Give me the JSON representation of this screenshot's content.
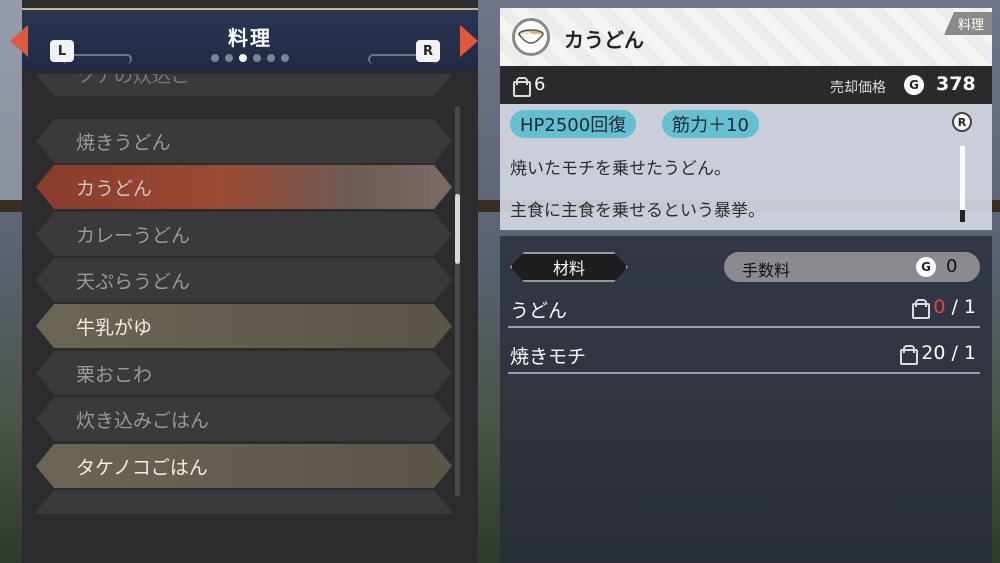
{
  "recipe_menu": {
    "title": "料理",
    "left_key": "L",
    "right_key": "R",
    "page_count": 6,
    "active_page": 3,
    "items": [
      {
        "label": "ツナの炊込ご",
        "state": "partial"
      },
      {
        "label": "焼きうどん",
        "state": "unavailable"
      },
      {
        "label": "カうどん",
        "state": "selected"
      },
      {
        "label": "カレーうどん",
        "state": "unavailable"
      },
      {
        "label": "天ぷらうどん",
        "state": "unavailable"
      },
      {
        "label": "牛乳がゆ",
        "state": "cookable"
      },
      {
        "label": "栗おこわ",
        "state": "unavailable"
      },
      {
        "label": "炊き込みごはん",
        "state": "unavailable"
      },
      {
        "label": "タケノコごはん",
        "state": "cookable"
      },
      {
        "label": "",
        "state": "partial"
      }
    ]
  },
  "detail": {
    "dish_name": "カうどん",
    "category": "料理",
    "dish_icon": "udon-bowl-icon",
    "owned_count": "6",
    "sell_label": "売却価格",
    "currency_symbol": "G",
    "sell_value": "378",
    "effects": [
      "HP2500回復",
      "筋力＋10"
    ],
    "description_lines": [
      "焼いたモチを乗せたうどん。",
      "主食に主食を乗せるという暴挙。"
    ],
    "scroll_key": "R"
  },
  "materials": {
    "tab_label": "材料",
    "fee_label": "手数料",
    "fee_currency": "G",
    "fee_value": "0",
    "rows": [
      {
        "name": "うどん",
        "have": "0",
        "need": "/ 1",
        "insufficient": true
      },
      {
        "name": "焼きモチ",
        "have": "20",
        "need": "/ 1",
        "insufficient": false
      }
    ]
  },
  "colors": {
    "selected": "#9a4a35",
    "cookable": "#6b6555",
    "unavailable": "#3a3a3d",
    "effect_badge": "#64bfd0",
    "arrow": "#e0593c",
    "insufficient": "#e5483a"
  }
}
